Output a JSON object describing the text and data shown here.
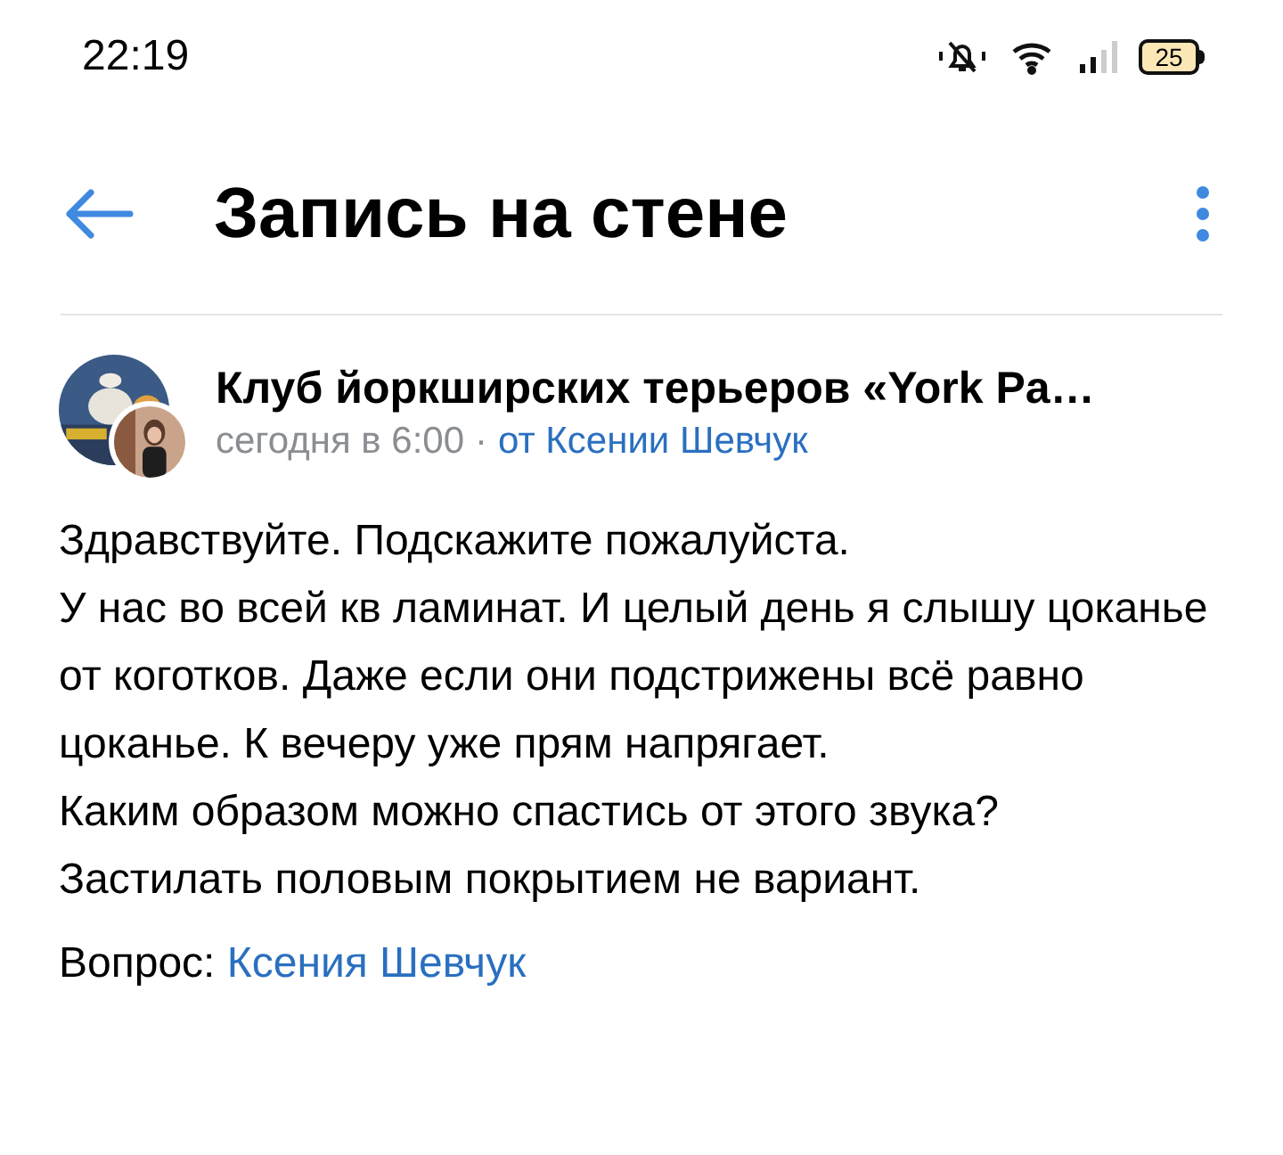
{
  "status_bar": {
    "time": "22:19",
    "battery": "25"
  },
  "header": {
    "title": "Запись на стене"
  },
  "post": {
    "author": "Клуб йоркширских терьеров «York Pa…",
    "time": "сегодня в 6:00",
    "separator": "·",
    "by": "от Ксении Шевчук",
    "paragraphs": [
      "Здравствуйте. Подскажите пожалуйста.",
      "У нас во всей кв ламинат. И целый день я слышу цоканье от коготков. Даже если они подстрижены всё равно цоканье. К вечеру уже прям напрягает.",
      "Каким образом можно спастись от этого звука? Застилать половым покрытием не вариант."
    ],
    "question_label": "Вопрос:",
    "question_author": "Ксения Шевчук"
  }
}
